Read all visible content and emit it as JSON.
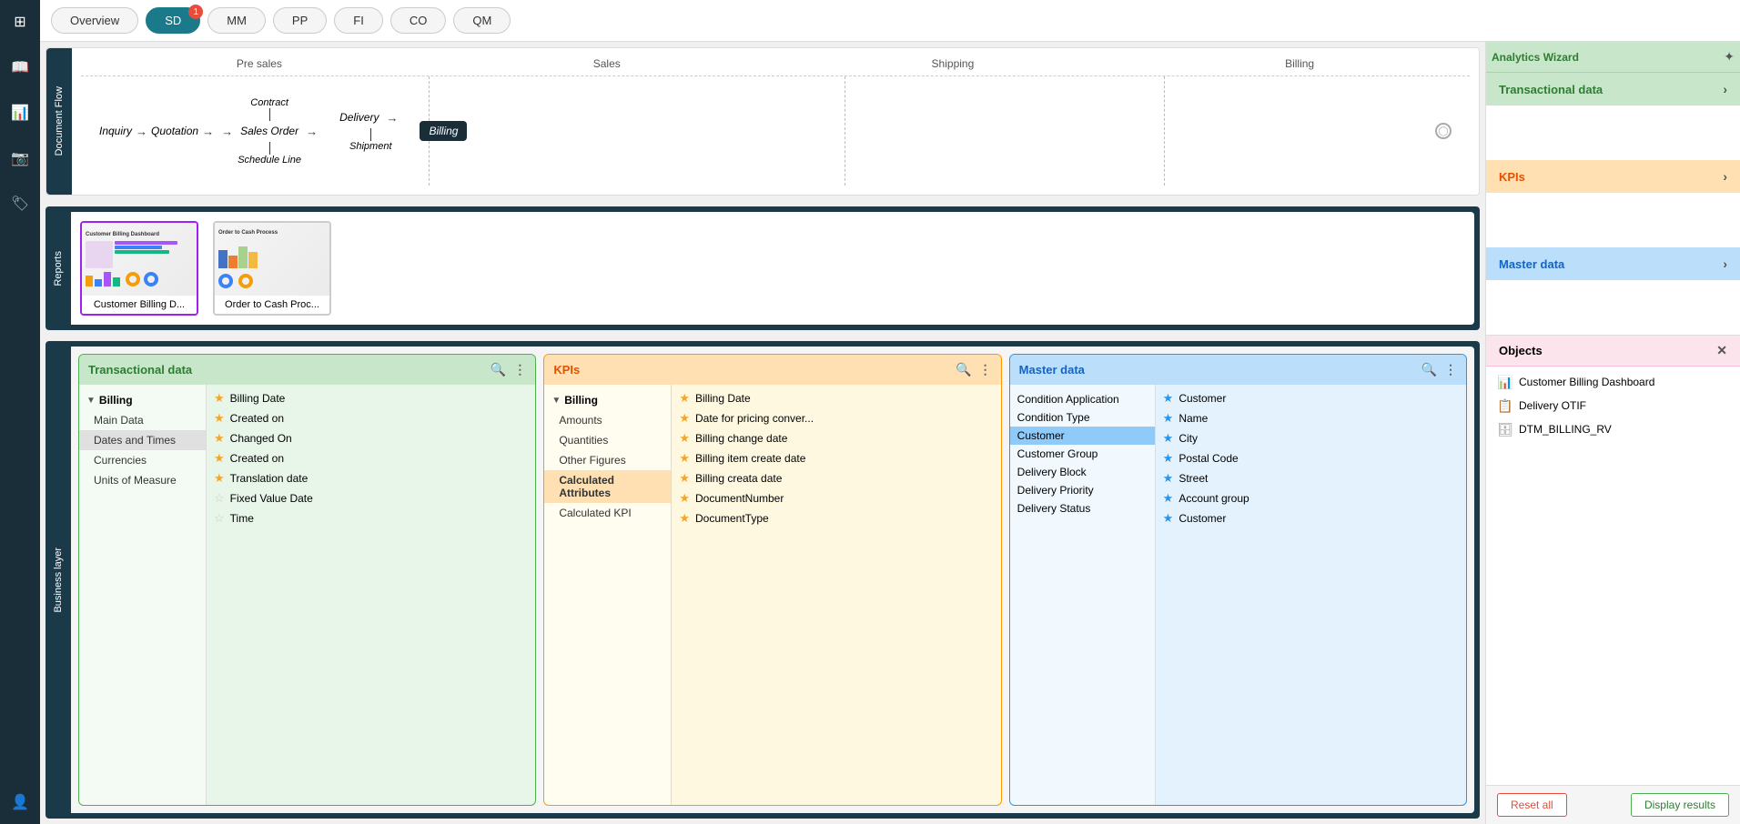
{
  "leftSidebar": {
    "icons": [
      {
        "name": "home-icon",
        "symbol": "⊞"
      },
      {
        "name": "book-icon",
        "symbol": "📖"
      },
      {
        "name": "chart-icon",
        "symbol": "📊"
      },
      {
        "name": "camera-icon",
        "symbol": "📷"
      },
      {
        "name": "tag-icon",
        "symbol": "🏷"
      },
      {
        "name": "user-circle-icon",
        "symbol": "👤"
      }
    ]
  },
  "tabs": {
    "items": [
      {
        "label": "Overview",
        "active": false
      },
      {
        "label": "SD",
        "active": true,
        "badge": "1"
      },
      {
        "label": "MM",
        "active": false
      },
      {
        "label": "PP",
        "active": false
      },
      {
        "label": "FI",
        "active": false
      },
      {
        "label": "CO",
        "active": false
      },
      {
        "label": "QM",
        "active": false
      }
    ]
  },
  "documentFlow": {
    "sectionLabel": "Document Flow",
    "stages": [
      "Pre sales",
      "Sales",
      "Shipping",
      "Billing"
    ],
    "nodes": {
      "inquiry": "Inquiry",
      "quotation": "Quotation",
      "contract": "Contract",
      "salesOrder": "Sales Order",
      "scheduleLine": "Schedule Line",
      "delivery": "Delivery",
      "shipment": "Shipment",
      "billing": "Billing"
    }
  },
  "reports": {
    "sectionLabel": "Reports",
    "items": [
      {
        "label": "Customer Billing D...",
        "fullLabel": "Customer Billing Dashboard"
      },
      {
        "label": "Order to Cash Proc...",
        "fullLabel": "Order to Cash Process"
      }
    ]
  },
  "businessLayer": {
    "sectionLabel": "Business layer",
    "transactional": {
      "title": "Transactional data",
      "sections": [
        {
          "name": "Billing",
          "items": [
            "Main Data",
            "Dates and Times",
            "Currencies",
            "Units of Measure"
          ]
        }
      ],
      "fields": [
        {
          "label": "Billing Date",
          "star": "filled"
        },
        {
          "label": "Created on",
          "star": "filled"
        },
        {
          "label": "Changed On",
          "star": "filled"
        },
        {
          "label": "Created on",
          "star": "filled"
        },
        {
          "label": "Translation date",
          "star": "filled"
        },
        {
          "label": "Fixed Value Date",
          "star": "empty"
        },
        {
          "label": "Time",
          "star": "empty"
        }
      ],
      "searchPlaceholder": "Search"
    },
    "kpis": {
      "title": "KPIs",
      "sections": [
        {
          "name": "Billing",
          "items": [
            "Amounts",
            "Quantities",
            "Other Figures",
            "Calculated Attributes",
            "Calculated KPI"
          ]
        }
      ],
      "fields": [
        {
          "label": "Billing Date",
          "star": "filled"
        },
        {
          "label": "Date for pricing conver...",
          "star": "filled"
        },
        {
          "label": "Billing change date",
          "star": "filled"
        },
        {
          "label": "Billing item create date",
          "star": "filled"
        },
        {
          "label": "Billing creata date",
          "star": "filled"
        },
        {
          "label": "DocumentNumber",
          "star": "filled"
        },
        {
          "label": "DocumentType",
          "star": "filled"
        }
      ],
      "searchPlaceholder": "Search"
    },
    "master": {
      "title": "Master data",
      "listItems": [
        {
          "label": "Condition Application",
          "selected": false
        },
        {
          "label": "Condition Type",
          "selected": false
        },
        {
          "label": "Customer",
          "selected": true
        },
        {
          "label": "Customer Group",
          "selected": false
        },
        {
          "label": "Delivery Block",
          "selected": false
        },
        {
          "label": "Delivery Priority",
          "selected": false
        },
        {
          "label": "Delivery Status",
          "selected": false
        }
      ],
      "fields": [
        {
          "label": "Customer",
          "star": "blue"
        },
        {
          "label": "Name",
          "star": "blue"
        },
        {
          "label": "City",
          "star": "blue"
        },
        {
          "label": "Postal Code",
          "star": "blue"
        },
        {
          "label": "Street",
          "star": "blue"
        },
        {
          "label": "Account group",
          "star": "blue"
        },
        {
          "label": "Customer",
          "star": "blue"
        }
      ],
      "searchPlaceholder": "Search"
    }
  },
  "rightPanel": {
    "analyticsWizardLabel": "Analytics Wizard",
    "transactional": {
      "title": "Transactional data",
      "content": ""
    },
    "kpis": {
      "title": "KPIs",
      "content": ""
    },
    "master": {
      "title": "Master data",
      "content": ""
    },
    "objects": {
      "title": "Objects",
      "items": [
        {
          "label": "Customer Billing Dashboard",
          "iconType": "report"
        },
        {
          "label": "Delivery OTIF",
          "iconType": "report2"
        },
        {
          "label": "DTM_BILLING_RV",
          "iconType": "data"
        }
      ]
    },
    "buttons": {
      "reset": "Reset all",
      "display": "Display results"
    }
  }
}
